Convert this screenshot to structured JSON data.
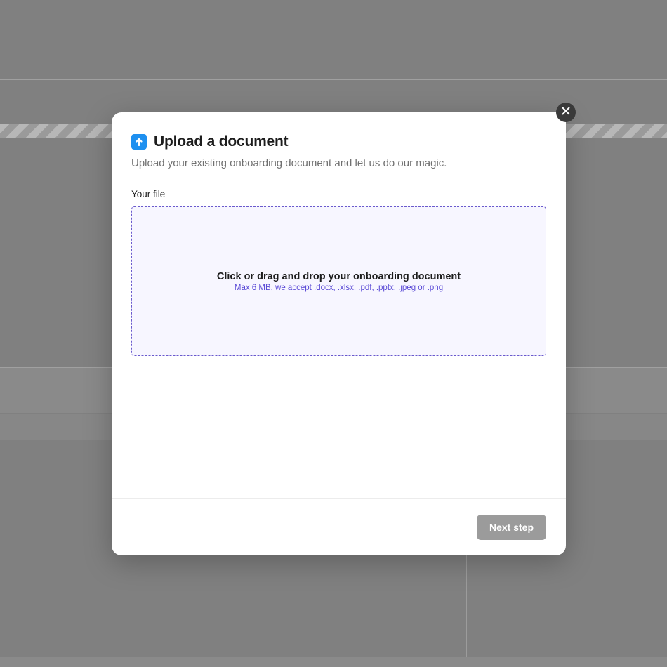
{
  "modal": {
    "title": "Upload a document",
    "subtitle": "Upload your existing onboarding document and let us do our magic.",
    "field_label": "Your file",
    "dropzone": {
      "main": "Click or drag and drop your onboarding document",
      "sub": "Max 6 MB, we accept .docx, .xlsx, .pdf, .pptx, .jpeg or .png"
    },
    "next_button": "Next step"
  }
}
